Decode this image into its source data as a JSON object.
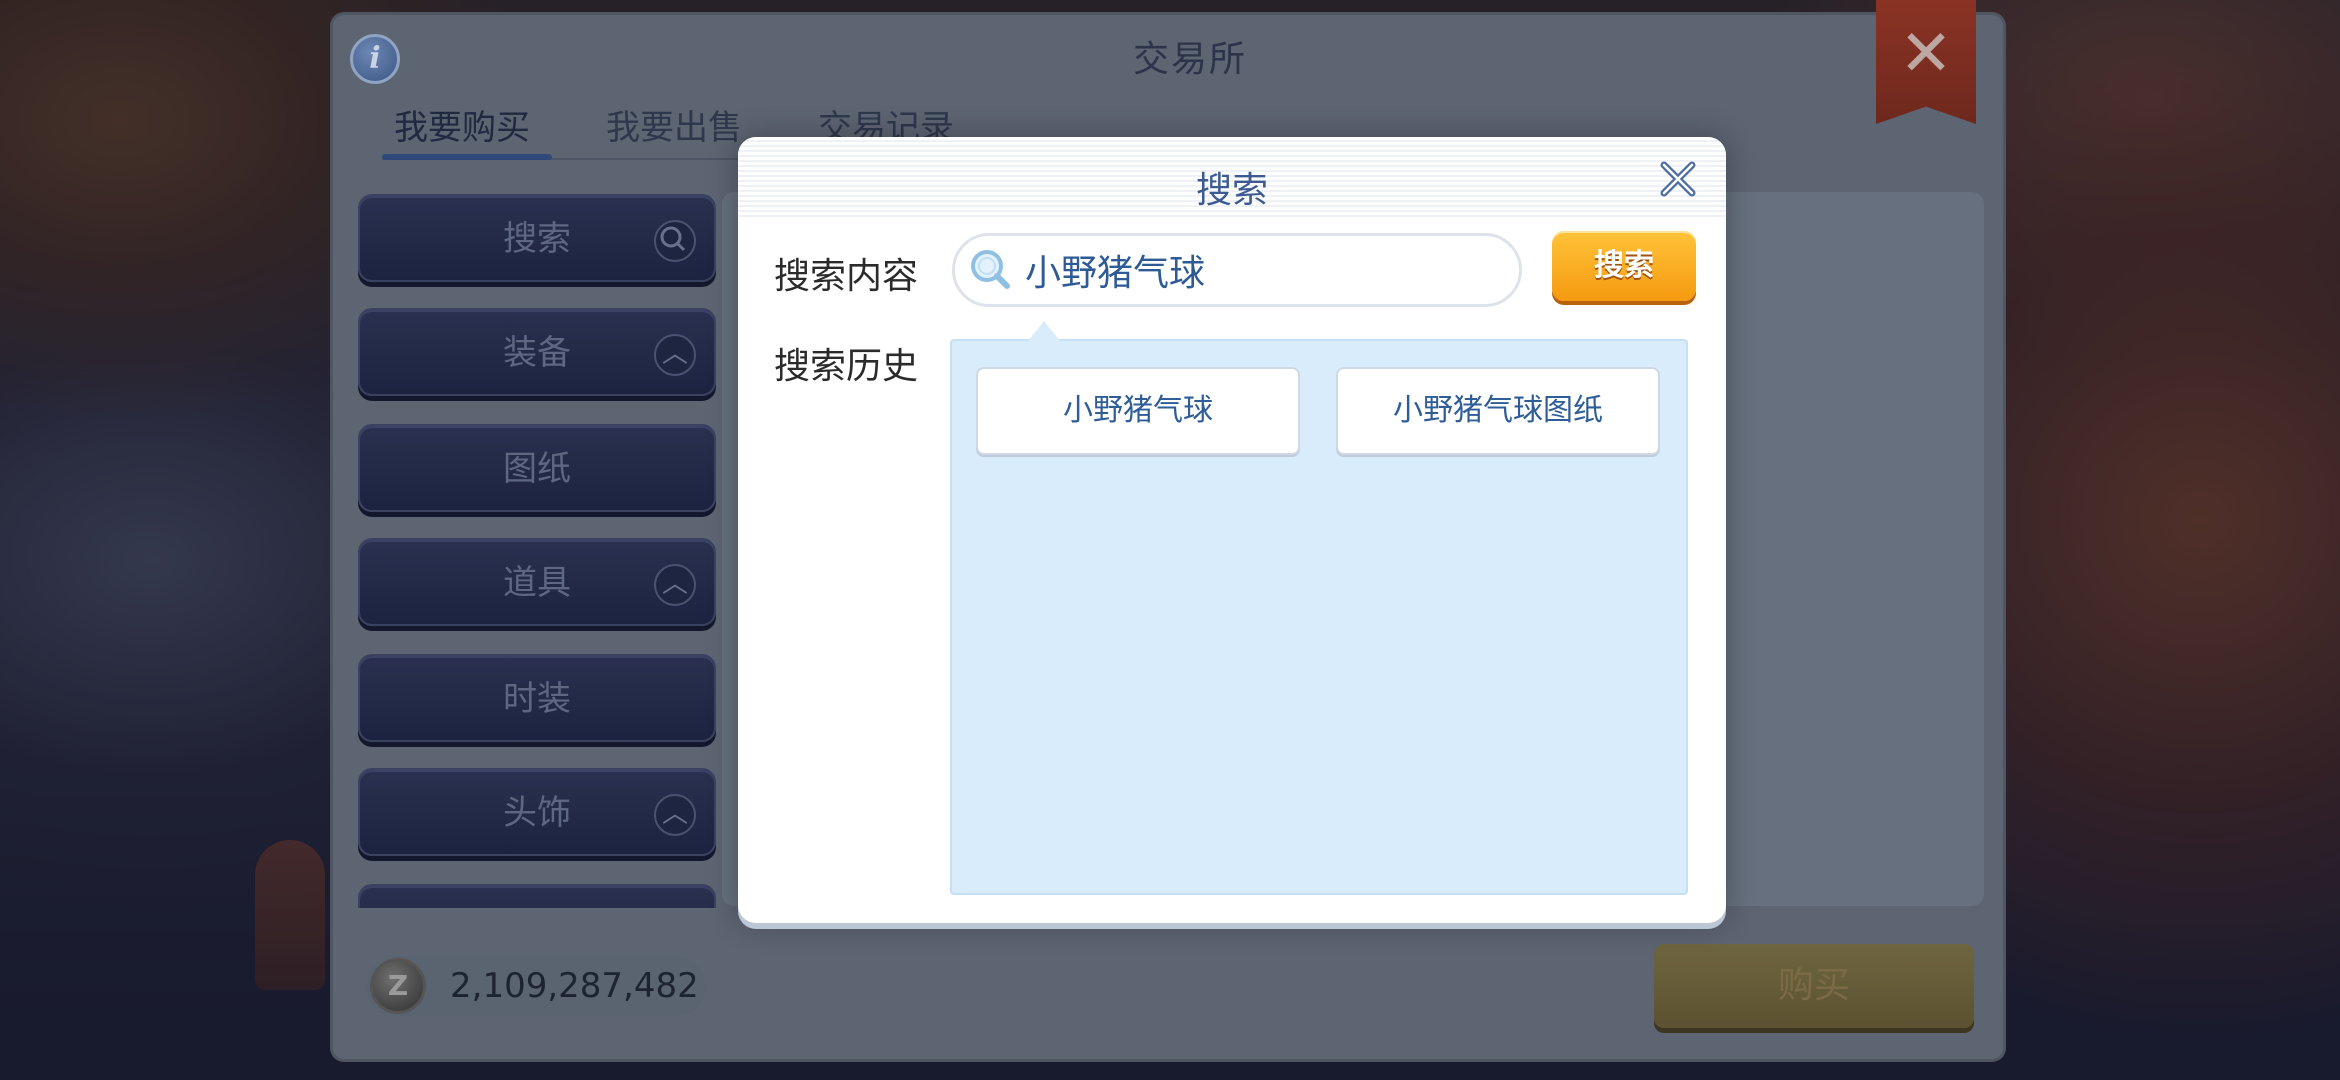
{
  "exchange": {
    "title": "交易所",
    "info_icon": "info-icon",
    "close_icon": "close-icon",
    "tabs": [
      {
        "label": "我要购买",
        "active": true
      },
      {
        "label": "我要出售",
        "active": false
      },
      {
        "label": "交易记录",
        "active": false
      }
    ],
    "categories": [
      {
        "label": "搜索",
        "icon": "search-icon"
      },
      {
        "label": "装备",
        "icon": "chevron-up-icon"
      },
      {
        "label": "图纸",
        "icon": ""
      },
      {
        "label": "道具",
        "icon": "chevron-up-icon"
      },
      {
        "label": "时装",
        "icon": ""
      },
      {
        "label": "头饰",
        "icon": "chevron-up-icon"
      }
    ],
    "zeny": "2,109,287,482",
    "buy_label": "购买"
  },
  "search_dialog": {
    "title": "搜索",
    "content_label": "搜索内容",
    "query": "小野猪气球",
    "search_button": "搜索",
    "history_label": "搜索历史",
    "history": [
      "小野猪气球",
      "小野猪气球图纸"
    ]
  },
  "colors": {
    "accent_blue": "#3d5b92",
    "button_orange": "#f59a10",
    "history_bg": "#d9ecfc"
  }
}
